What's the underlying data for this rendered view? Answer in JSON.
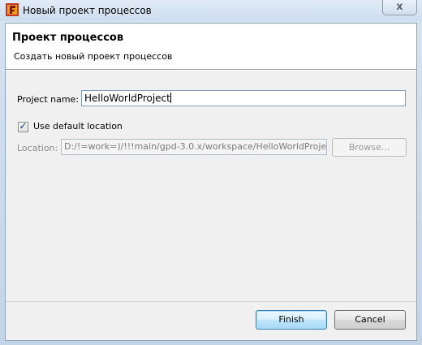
{
  "window": {
    "title": "Новый проект процессов",
    "close_glyph": "x"
  },
  "banner": {
    "title": "Проект процессов",
    "description": "Создать новый проект процессов"
  },
  "form": {
    "project_name_label": "Project name:",
    "project_name_value": "HelloWorldProject",
    "use_default_label": "Use default location",
    "use_default_checked": true,
    "checkmark": "✓",
    "location_label": "Location:",
    "location_value": "D:/!=work=)/!!!main/gpd-3.0.x/workspace/HelloWorldProjec",
    "browse_label": "Browse..."
  },
  "footer": {
    "finish_label": "Finish",
    "cancel_label": "Cancel"
  },
  "icons": {
    "app": "app-logo-icon",
    "close": "close-icon",
    "check": "check-icon"
  },
  "colors": {
    "default_button_border": "#3c7fb1",
    "textbox_border": "#7f9db9"
  }
}
